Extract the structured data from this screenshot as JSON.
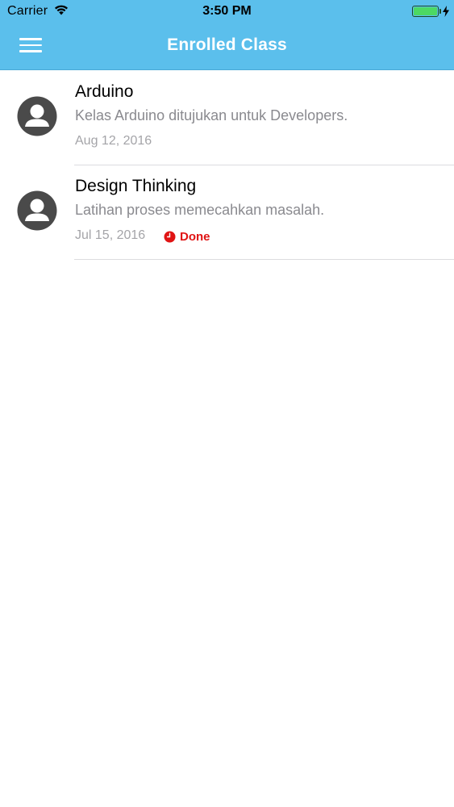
{
  "status_bar": {
    "carrier": "Carrier",
    "time": "3:50 PM",
    "battery_color": "#4cd964"
  },
  "header": {
    "title": "Enrolled Class",
    "background_color": "#5bbfec",
    "menu_icon": "hamburger-menu-icon"
  },
  "classes": [
    {
      "title": "Arduino",
      "description": "Kelas Arduino ditujukan untuk Developers.",
      "date": "Aug 12, 2016",
      "avatar_icon": "user-avatar-icon"
    },
    {
      "title": "Design Thinking",
      "description": "Latihan proses memecahkan masalah.",
      "date": "Jul 15, 2016",
      "status": "Done",
      "status_icon": "clock-icon",
      "status_color": "#e01414",
      "avatar_icon": "user-avatar-icon"
    }
  ]
}
